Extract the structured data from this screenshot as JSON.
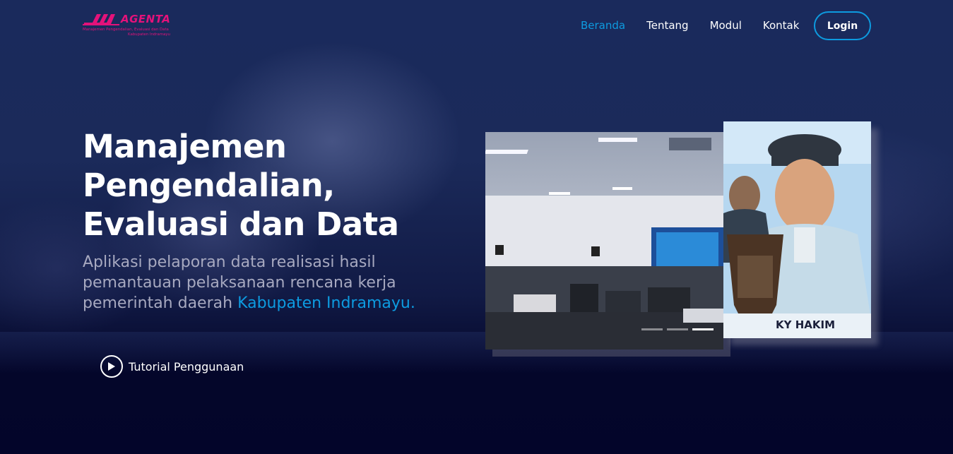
{
  "brand": {
    "name": "AGENTA",
    "subtitle_line1": "Manajemen Pengendalian, Evaluasi dan Data",
    "subtitle_line2": "Kabupaten Indramayu",
    "color": "#e4127a"
  },
  "nav": {
    "items": [
      {
        "label": "Beranda",
        "active": true
      },
      {
        "label": "Tentang",
        "active": false
      },
      {
        "label": "Modul",
        "active": false
      },
      {
        "label": "Kontak",
        "active": false
      }
    ],
    "login_label": "Login",
    "accent": "#0d9be0"
  },
  "hero": {
    "title": "Manajemen Pengendalian, Evaluasi dan Data",
    "desc_part1": "Aplikasi pelaporan data realisasi hasil pemantauan pelaksanaan rencana kerja pemerintah daerah ",
    "desc_highlight": "Kabupaten Indramayu.",
    "tutorial_label": "Tutorial Penggunaan",
    "tutorial_icon": "play-icon"
  },
  "carousel": {
    "slides": 3,
    "active_slide": 3,
    "side_caption": "KY HAKIM"
  }
}
